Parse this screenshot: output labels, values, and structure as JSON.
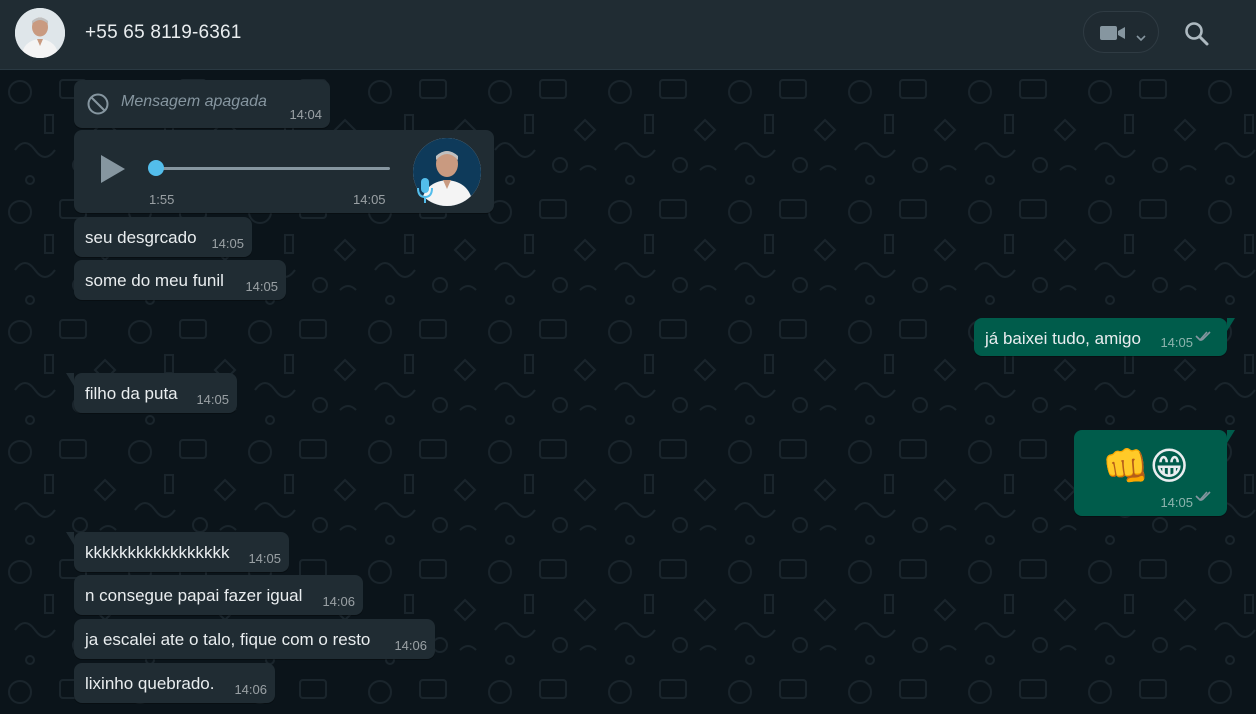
{
  "header": {
    "contact_name": "+55 65 8119-6361",
    "avatar_icon": "contact-avatar",
    "video_icon": "video-camera-icon",
    "search_icon": "search-icon"
  },
  "colors": {
    "header_bg": "#202c33",
    "chat_bg": "#0b141a",
    "incoming_bubble": "#202c33",
    "outgoing_bubble": "#005c4b",
    "voice_progress": "#53bdeb",
    "read_ticks": "#8696a0"
  },
  "messages": {
    "m1": {
      "type": "deleted",
      "text": "Mensagem apagada",
      "time": "14:04"
    },
    "m2": {
      "type": "voice",
      "duration": "1:55",
      "time": "14:05",
      "progress": 0
    },
    "m3": {
      "text": "seu desgrcado",
      "time": "14:05"
    },
    "m4": {
      "text": "some do meu funil",
      "time": "14:05"
    },
    "m5": {
      "text": "já baixei tudo, amigo",
      "time": "14:05",
      "status": "read"
    },
    "m6": {
      "text": "filho da puta",
      "time": "14:05"
    },
    "m7": {
      "text": "👊😁",
      "time": "14:05",
      "status": "read"
    },
    "m8": {
      "text": "kkkkkkkkkkkkkkkkk",
      "time": "14:05"
    },
    "m9": {
      "text": "n consegue papai fazer igual",
      "time": "14:06"
    },
    "m10": {
      "text": "ja escalei ate o talo, fique com o resto",
      "time": "14:06"
    },
    "m11": {
      "text": "lixinho quebrado.",
      "time": "14:06"
    }
  }
}
